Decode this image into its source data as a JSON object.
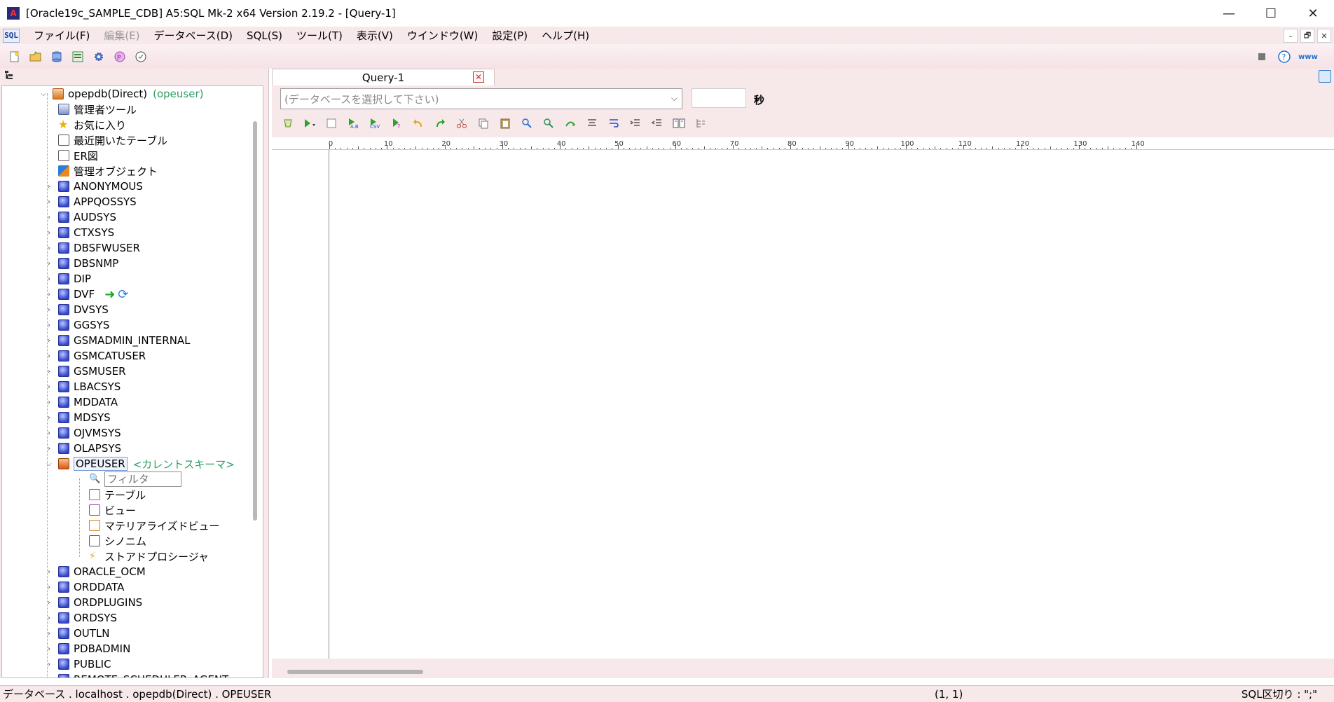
{
  "window": {
    "title": "[Oracle19c_SAMPLE_CDB] A5:SQL Mk-2 x64 Version 2.19.2 - [Query-1]",
    "controls": [
      "—",
      "☐",
      "✕"
    ]
  },
  "menu": {
    "icon_text": "SQL",
    "items": [
      {
        "label": "ファイル(F)",
        "disabled": false
      },
      {
        "label": "編集(E)",
        "disabled": true
      },
      {
        "label": "データベース(D)",
        "disabled": false
      },
      {
        "label": "SQL(S)",
        "disabled": false
      },
      {
        "label": "ツール(T)",
        "disabled": false
      },
      {
        "label": "表示(V)",
        "disabled": false
      },
      {
        "label": "ウインドウ(W)",
        "disabled": false
      },
      {
        "label": "設定(P)",
        "disabled": false
      },
      {
        "label": "ヘルプ(H)",
        "disabled": false
      }
    ],
    "mdi_controls": [
      "–",
      "🗗",
      "✕"
    ]
  },
  "toolbar": {
    "buttons": [
      "new-file-icon",
      "open-folder-icon",
      "database-icon",
      "database-tree-icon",
      "gear-icon",
      "plugin-icon",
      "clock-icon"
    ],
    "right": [
      "stop-icon",
      "help-icon",
      "web-icon"
    ],
    "web_label": "www"
  },
  "tree": {
    "root": {
      "label": "opepdb(Direct)",
      "user": "(opeuser)"
    },
    "fixed_items": [
      "管理者ツール",
      "お気に入り",
      "最近開いたテーブル",
      "ER図",
      "管理オブジェクト"
    ],
    "schemas_before": [
      "ANONYMOUS",
      "APPQOSSYS",
      "AUDSYS",
      "CTXSYS",
      "DBSFWUSER",
      "DBSNMP",
      "DIP",
      "DVF",
      "DVSYS",
      "GGSYS",
      "GSMADMIN_INTERNAL",
      "GSMCATUSER",
      "GSMUSER",
      "LBACSYS",
      "MDDATA",
      "MDSYS",
      "OJVMSYS",
      "OLAPSYS"
    ],
    "current_schema": {
      "label": "OPEUSER",
      "tag": "<カレントスキーマ>"
    },
    "filter_placeholder": "フィルタ",
    "current_children": [
      "テーブル",
      "ビュー",
      "マテリアライズドビュー",
      "シノニム",
      "ストアドプロシージャ"
    ],
    "schemas_after": [
      "ORACLE_OCM",
      "ORDDATA",
      "ORDPLUGINS",
      "ORDSYS",
      "OUTLN",
      "PDBADMIN",
      "PUBLIC",
      "REMOTE_SCHEDULER_AGENT"
    ]
  },
  "query": {
    "tab_label": "Query-1",
    "db_placeholder": "(データベースを選択して下さい)",
    "seconds_label": "秒",
    "ruler_marks": [
      "0",
      "10",
      "20",
      "30",
      "40",
      "50",
      "60",
      "70",
      "80",
      "90",
      "100",
      "110",
      "120",
      "130",
      "140"
    ]
  },
  "status": {
    "path": "データベース . localhost . opepdb(Direct) . OPEUSER",
    "position": "(1, 1)",
    "sql_separator": "SQL区切り : \";\""
  },
  "colors": {
    "chrome_pink": "#f7e8ea",
    "current_schema_tag": "#2e9e63",
    "tab_close": "#c03b3b"
  }
}
